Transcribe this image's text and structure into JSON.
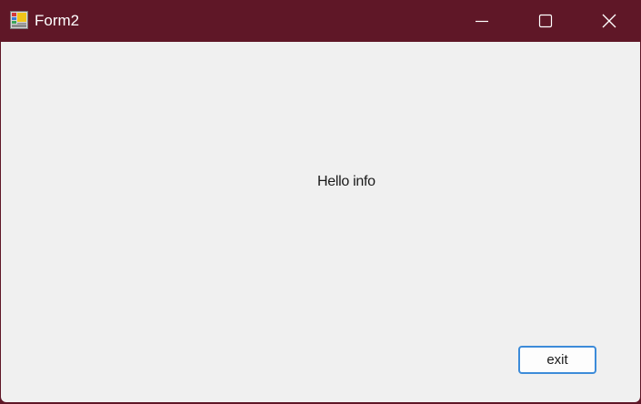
{
  "window": {
    "title": "Form2",
    "icon": "winforms-app-icon",
    "titlebar_color": "#5f1727",
    "controls": {
      "minimize_icon": "minimize-icon",
      "maximize_icon": "maximize-icon",
      "close_icon": "close-icon"
    }
  },
  "form": {
    "background_color": "#f0f0f0",
    "label_text": "Hello info",
    "exit_button_label": "exit",
    "exit_button_border_color": "#3c8bd9"
  }
}
